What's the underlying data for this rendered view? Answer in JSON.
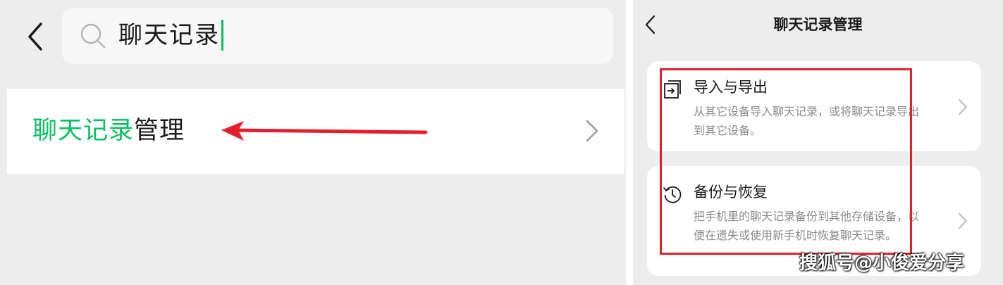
{
  "search": {
    "query": "聊天记录"
  },
  "result": {
    "highlight": "聊天记录",
    "rest": "管理"
  },
  "manage": {
    "title": "聊天记录管理",
    "items": [
      {
        "icon": "import-export-icon",
        "title": "导入与导出",
        "desc": "从其它设备导入聊天记录，或将聊天记录导出到其它设备。"
      },
      {
        "icon": "backup-restore-icon",
        "title": "备份与恢复",
        "desc": "把手机里的聊天记录备份到其他存储设备，以便在遗失或使用新手机时恢复聊天记录。"
      }
    ]
  },
  "watermark": "搜狐号@小俊爱分享",
  "colors": {
    "accent_green": "#07c160",
    "annotation_red": "#e2202c"
  }
}
